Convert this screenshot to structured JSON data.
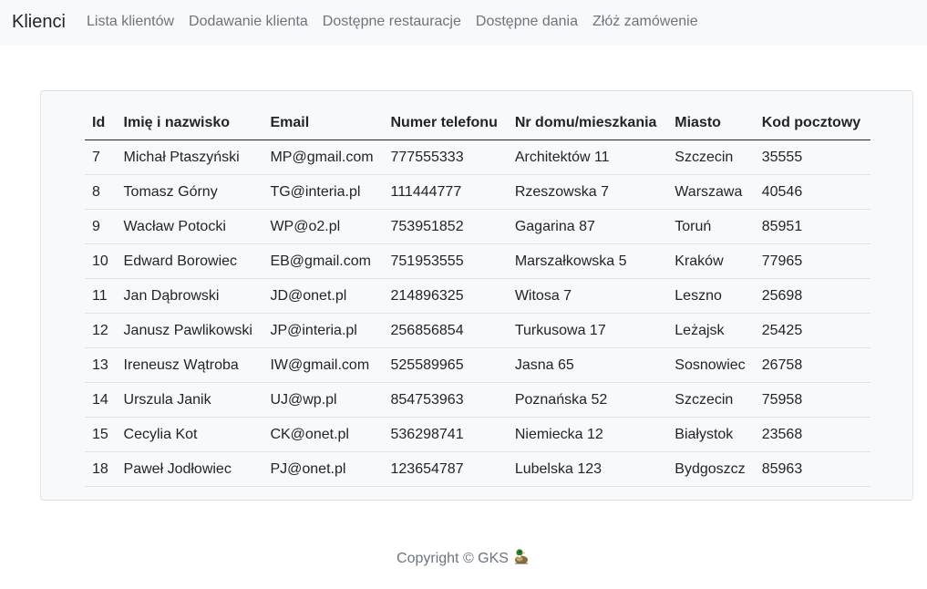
{
  "navbar": {
    "brand": "Klienci",
    "links": [
      {
        "label": "Lista klientów"
      },
      {
        "label": "Dodawanie klienta"
      },
      {
        "label": "Dostępne restauracje"
      },
      {
        "label": "Dostępne dania"
      },
      {
        "label": "Złóż zamówenie"
      }
    ]
  },
  "table": {
    "headers": [
      "Id",
      "Imię i nazwisko",
      "Email",
      "Numer telefonu",
      "Nr domu/mieszkania",
      "Miasto",
      "Kod pocztowy"
    ],
    "rows": [
      [
        "7",
        "Michał Ptaszyński",
        "MP@gmail.com",
        "777555333",
        "Architektów 11",
        "Szczecin",
        "35555"
      ],
      [
        "8",
        "Tomasz Górny",
        "TG@interia.pl",
        "111444777",
        "Rzeszowska 7",
        "Warszawa",
        "40546"
      ],
      [
        "9",
        "Wacław Potocki",
        "WP@o2.pl",
        "753951852",
        "Gagarina 87",
        "Toruń",
        "85951"
      ],
      [
        "10",
        "Edward Borowiec",
        "EB@gmail.com",
        "751953555",
        "Marszałkowska 5",
        "Kraków",
        "77965"
      ],
      [
        "11",
        "Jan Dąbrowski",
        "JD@onet.pl",
        "214896325",
        "Witosa 7",
        "Leszno",
        "25698"
      ],
      [
        "12",
        "Janusz Pawlikowski",
        "JP@interia.pl",
        "256856854",
        "Turkusowa 17",
        "Leżajsk",
        "25425"
      ],
      [
        "13",
        "Ireneusz Wątroba",
        "IW@gmail.com",
        "525589965",
        "Jasna 65",
        "Sosnowiec",
        "26758"
      ],
      [
        "14",
        "Urszula Janik",
        "UJ@wp.pl",
        "854753963",
        "Poznańska 52",
        "Szczecin",
        "75958"
      ],
      [
        "15",
        "Cecylia Kot",
        "CK@onet.pl",
        "536298741",
        "Niemiecka 12",
        "Białystok",
        "23568"
      ],
      [
        "18",
        "Paweł Jodłowiec",
        "PJ@onet.pl",
        "123654787",
        "Lubelska 123",
        "Bydgoszcz",
        "85963"
      ]
    ]
  },
  "footer": {
    "text": "Copyright © GKS",
    "icon": "duck-icon"
  }
}
